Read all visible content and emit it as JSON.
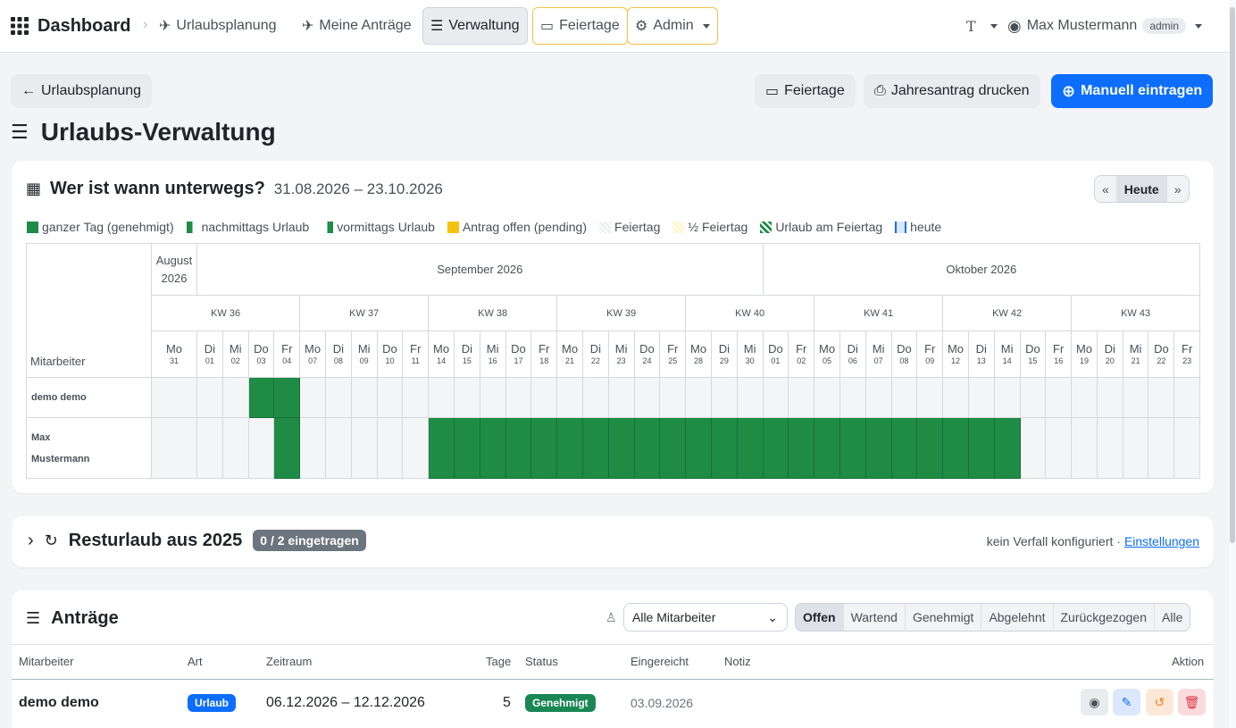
{
  "nav": {
    "brand": "Dashboard",
    "items": [
      "Urlaubsplanung",
      "Meine Anträge",
      "Verwaltung",
      "Feiertage",
      "Admin"
    ],
    "lang": "T",
    "user": "Max Mustermann",
    "role": "admin"
  },
  "toolbar": {
    "back": "Urlaubsplanung",
    "holidays": "Feiertage",
    "print": "Jahresantrag drucken",
    "manual": "Manuell eintragen"
  },
  "page_title": "Urlaubs-Verwaltung",
  "calendar": {
    "title": "Wer ist wann unterwegs?",
    "range": "31.08.2026 – 23.10.2026",
    "today_button": "Heute",
    "legend": [
      "ganzer Tag (genehmigt)",
      "nachmittags Urlaub",
      "vormittags Urlaub",
      "Antrag offen (pending)",
      "Feiertag",
      "½ Feiertag",
      "Urlaub am Feiertag",
      "heute"
    ],
    "employee_header": "Mitarbeiter",
    "months": [
      {
        "label": "August 2026",
        "days": 1
      },
      {
        "label": "September 2026",
        "days": 22
      },
      {
        "label": "Oktober 2026",
        "days": 17
      }
    ],
    "weeks": [
      {
        "label": "KW 36",
        "days": 5
      },
      {
        "label": "KW 37",
        "days": 5
      },
      {
        "label": "KW 38",
        "days": 5
      },
      {
        "label": "KW 39",
        "days": 5
      },
      {
        "label": "KW 40",
        "days": 5
      },
      {
        "label": "KW 41",
        "days": 5
      },
      {
        "label": "KW 42",
        "days": 5
      },
      {
        "label": "KW 43",
        "days": 5
      }
    ],
    "days": [
      [
        "Mo",
        "31"
      ],
      [
        "Di",
        "01"
      ],
      [
        "Mi",
        "02"
      ],
      [
        "Do",
        "03"
      ],
      [
        "Fr",
        "04"
      ],
      [
        "Mo",
        "07"
      ],
      [
        "Di",
        "08"
      ],
      [
        "Mi",
        "09"
      ],
      [
        "Do",
        "10"
      ],
      [
        "Fr",
        "11"
      ],
      [
        "Mo",
        "14"
      ],
      [
        "Di",
        "15"
      ],
      [
        "Mi",
        "16"
      ],
      [
        "Do",
        "17"
      ],
      [
        "Fr",
        "18"
      ],
      [
        "Mo",
        "21"
      ],
      [
        "Di",
        "22"
      ],
      [
        "Mi",
        "23"
      ],
      [
        "Do",
        "24"
      ],
      [
        "Fr",
        "25"
      ],
      [
        "Mo",
        "28"
      ],
      [
        "Di",
        "29"
      ],
      [
        "Mi",
        "30"
      ],
      [
        "Do",
        "01"
      ],
      [
        "Fr",
        "02"
      ],
      [
        "Mo",
        "05"
      ],
      [
        "Di",
        "06"
      ],
      [
        "Mi",
        "07"
      ],
      [
        "Do",
        "08"
      ],
      [
        "Fr",
        "09"
      ],
      [
        "Mo",
        "12"
      ],
      [
        "Di",
        "13"
      ],
      [
        "Mi",
        "14"
      ],
      [
        "Do",
        "15"
      ],
      [
        "Fr",
        "16"
      ],
      [
        "Mo",
        "19"
      ],
      [
        "Di",
        "20"
      ],
      [
        "Mi",
        "21"
      ],
      [
        "Do",
        "22"
      ],
      [
        "Fr",
        "23"
      ]
    ],
    "employees": [
      {
        "name": "demo demo",
        "vacation_days": [
          3,
          4
        ]
      },
      {
        "name": "Max Mustermann",
        "vacation_days": [
          4,
          10,
          11,
          12,
          13,
          14,
          15,
          16,
          17,
          18,
          19,
          20,
          21,
          22,
          23,
          24,
          25,
          26,
          27,
          28,
          29,
          30,
          31,
          32
        ]
      }
    ]
  },
  "carryover": {
    "title": "Resturlaub aus 2025",
    "badge": "0 / 2 eingetragen",
    "note": "kein Verfall konfiguriert ·",
    "link": "Einstellungen"
  },
  "requests": {
    "title": "Anträge",
    "employee_select": "Alle Mitarbeiter",
    "filters": [
      "Offen",
      "Wartend",
      "Genehmigt",
      "Abgelehnt",
      "Zurückgezogen",
      "Alle"
    ],
    "active_filter": "Offen",
    "columns": [
      "Mitarbeiter",
      "Art",
      "Zeitraum",
      "Tage",
      "Status",
      "Eingereicht",
      "Notiz",
      "Aktion"
    ],
    "rows": [
      {
        "employee": "demo demo",
        "type": "Urlaub",
        "period": "06.12.2026 – 12.12.2026",
        "days": "5",
        "status": "Genehmigt",
        "submitted": "03.09.2026",
        "note": ""
      }
    ]
  },
  "colors": {
    "approved": "#1e8c45",
    "primary": "#0d6efd",
    "pending": "#f5c211",
    "status_approved": "#198754"
  }
}
